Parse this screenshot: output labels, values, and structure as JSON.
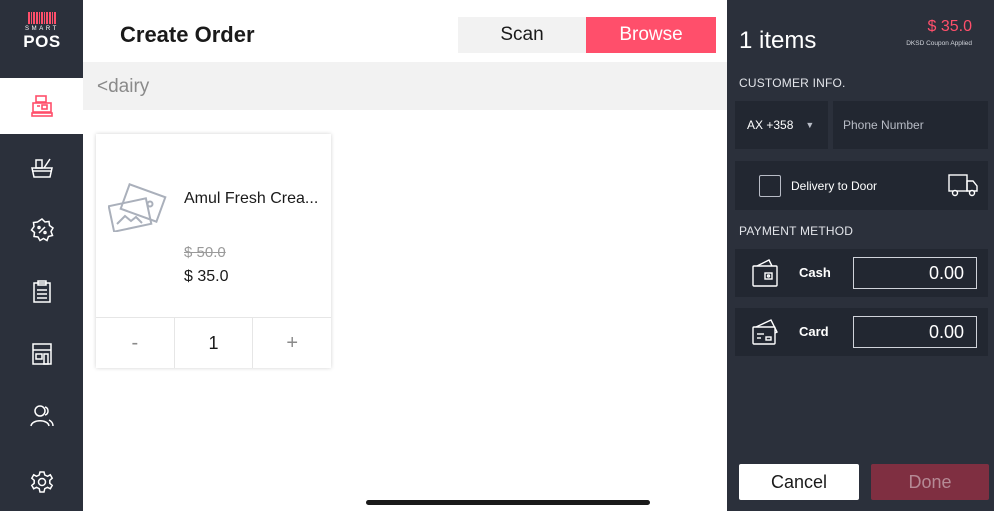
{
  "app": {
    "logo_small": "SMART",
    "logo_big": "POS"
  },
  "sidebar": {
    "items": [
      {
        "icon": "cash-register-icon",
        "active": true
      },
      {
        "icon": "basket-icon",
        "active": false
      },
      {
        "icon": "discount-badge-icon",
        "active": false
      },
      {
        "icon": "clipboard-icon",
        "active": false
      },
      {
        "icon": "store-icon",
        "active": false
      },
      {
        "icon": "customers-icon",
        "active": false
      },
      {
        "icon": "settings-gear-icon",
        "active": false
      }
    ]
  },
  "header": {
    "title": "Create Order",
    "segments": [
      "Scan",
      "Browse"
    ],
    "active_segment": "Browse"
  },
  "breadcrumb": "<dairy",
  "product": {
    "name": "Amul Fresh Crea...",
    "original_price": "$ 50.0",
    "price": "$ 35.0",
    "quantity": "1",
    "minus_label": "-",
    "plus_label": "+"
  },
  "cart": {
    "items_count": "1 items",
    "total": "$ 35.0",
    "coupon_note": "DKSD Coupon Applied",
    "customer_label": "CUSTOMER INFO.",
    "country_code": "AX +358",
    "country_arrow": "▼",
    "phone_placeholder": "Phone Number",
    "delivery_label": "Delivery to Door",
    "payment_label": "PAYMENT METHOD",
    "payments": [
      {
        "label": "Cash",
        "amount": "0.00"
      },
      {
        "label": "Card",
        "amount": "0.00"
      }
    ],
    "cancel_label": "Cancel",
    "done_label": "Done"
  },
  "colors": {
    "accent": "#ff4f6b",
    "dark_panel": "#2b303b",
    "field_bg": "#222731"
  }
}
